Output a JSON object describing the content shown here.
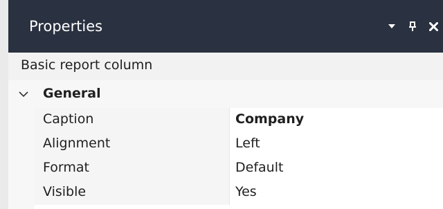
{
  "panel": {
    "title": "Properties",
    "controls": {
      "dropdown_icon": "chevron-down-icon",
      "pin_icon": "pin-icon",
      "close_icon": "close-icon"
    },
    "object_name": "Basic report column"
  },
  "grid": {
    "category": {
      "label": "General",
      "expanded": true
    },
    "rows": [
      {
        "name": "Caption",
        "value": "Company",
        "value_bold": true
      },
      {
        "name": "Alignment",
        "value": "Left"
      },
      {
        "name": "Format",
        "value": "Default"
      },
      {
        "name": "Visible",
        "value": "Yes"
      }
    ]
  },
  "colors": {
    "titlebar": "#2a3140",
    "title_text": "#ffffff",
    "panel_bg": "#f0f0f0"
  }
}
